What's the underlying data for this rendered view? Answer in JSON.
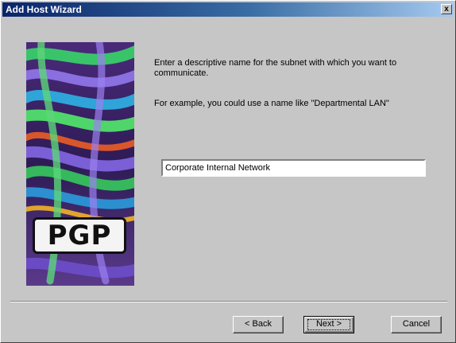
{
  "window": {
    "title": "Add Host Wizard",
    "close_glyph": "x"
  },
  "banner": {
    "logo_text": "PGP"
  },
  "main": {
    "instruction": "Enter a descriptive name for the subnet with which you want to communicate.",
    "example": "For example, you could use a name like \"Departmental LAN\"",
    "name_field_value": "Corporate Internal Network"
  },
  "buttons": {
    "back": "< Back",
    "next": "Next >",
    "cancel": "Cancel"
  }
}
